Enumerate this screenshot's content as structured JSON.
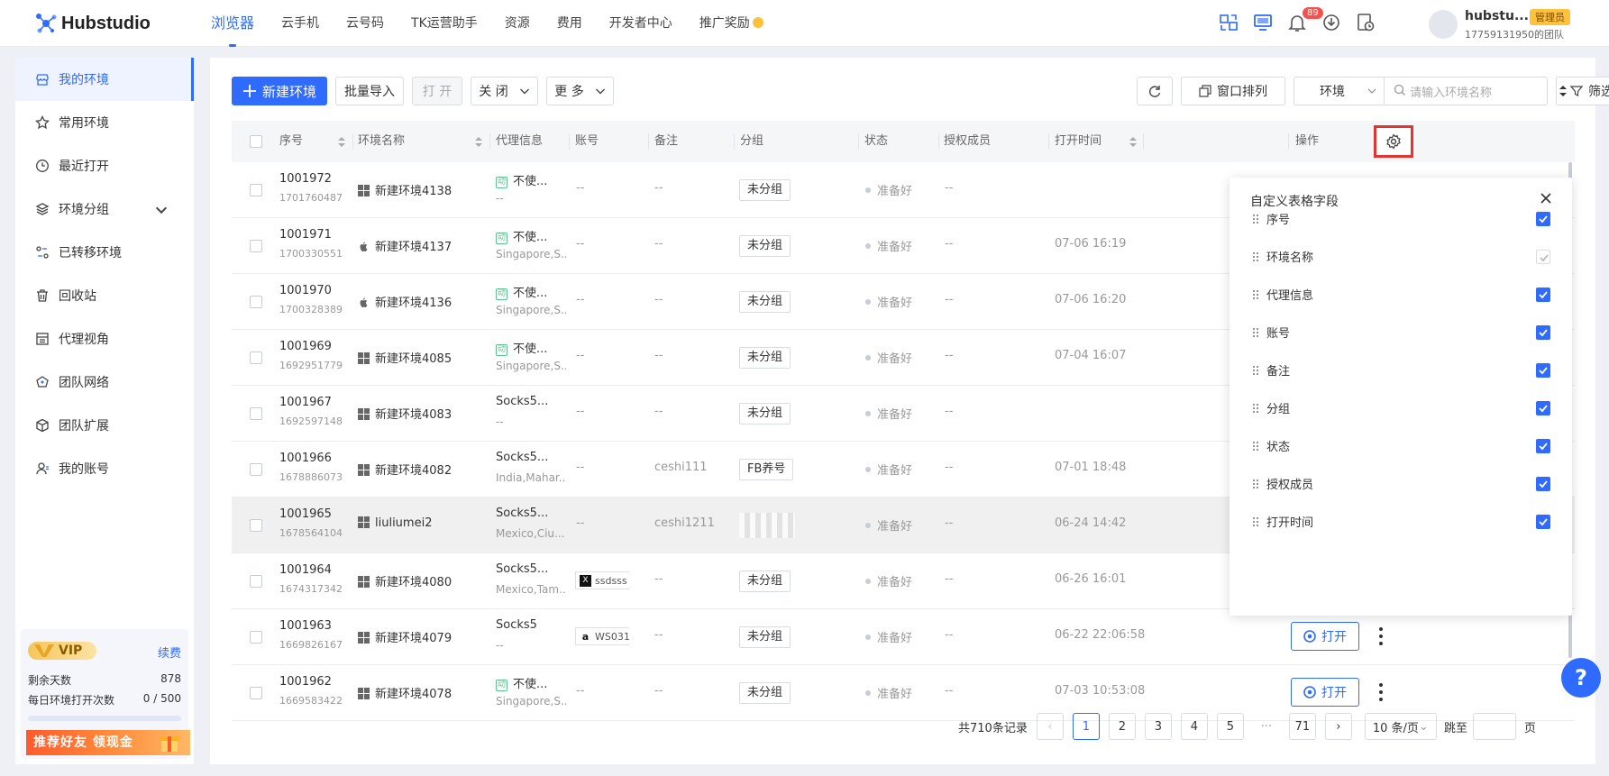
{
  "app": {
    "logo_text": "Hubstudio"
  },
  "nav": {
    "items": [
      "浏览器",
      "云手机",
      "云号码",
      "TK运营助手",
      "资源",
      "费用",
      "开发者中心",
      "推广奖励"
    ]
  },
  "header": {
    "notification_count": "89",
    "user_name": "hubstu...",
    "role": "管理员",
    "team": "17759131950的团队"
  },
  "sidebar": {
    "items": [
      "我的环境",
      "常用环境",
      "最近打开",
      "环境分组",
      "已转移环境",
      "回收站",
      "代理视角",
      "团队网络",
      "团队扩展",
      "我的账号"
    ]
  },
  "vip": {
    "label": "VIP",
    "renew": "续费",
    "days_label": "剩余天数",
    "days_value": "878",
    "opens_label": "每日环境打开次数",
    "opens_value": "0 / 500",
    "promo": "推荐好友 领现金"
  },
  "toolbar": {
    "new_env": "新建环境",
    "batch_import": "批量导入",
    "open": "打 开",
    "close": "关 闭",
    "more": "更 多",
    "window_arrange": "窗口排列",
    "env_select": "环境",
    "search_placeholder": "请输入环境名称",
    "filter": "筛选"
  },
  "table": {
    "headers": [
      "序号",
      "环境名称",
      "代理信息",
      "账号",
      "备注",
      "分组",
      "状态",
      "授权成员",
      "打开时间",
      "操作"
    ],
    "rows": [
      {
        "id": "1001972",
        "sub": "1701760487",
        "os": "windows",
        "name": "新建环境4138",
        "proxy_tag": "动",
        "proxy": "不使...",
        "proxy_sub": "--",
        "account": "--",
        "note": "--",
        "group": "未分组",
        "status": "准备好",
        "members": "--",
        "time": "",
        "highlight": false
      },
      {
        "id": "1001971",
        "sub": "1700330551",
        "os": "apple",
        "name": "新建环境4137",
        "proxy_tag": "动",
        "proxy": "不使...",
        "proxy_sub": "Singapore,S...",
        "account": "--",
        "note": "--",
        "group": "未分组",
        "status": "准备好",
        "members": "--",
        "time": "07-06 16:19",
        "highlight": false
      },
      {
        "id": "1001970",
        "sub": "1700328389",
        "os": "apple",
        "name": "新建环境4136",
        "proxy_tag": "动",
        "proxy": "不使...",
        "proxy_sub": "Singapore,S...",
        "account": "--",
        "note": "--",
        "group": "未分组",
        "status": "准备好",
        "members": "--",
        "time": "07-06 16:20",
        "highlight": false
      },
      {
        "id": "1001969",
        "sub": "1692951779",
        "os": "windows",
        "name": "新建环境4085",
        "proxy_tag": "动",
        "proxy": "不使...",
        "proxy_sub": "Singapore,S...",
        "account": "--",
        "note": "--",
        "group": "未分组",
        "status": "准备好",
        "members": "--",
        "time": "07-04 16:07",
        "highlight": false
      },
      {
        "id": "1001967",
        "sub": "1692597148",
        "os": "windows",
        "name": "新建环境4083",
        "proxy_tag": "",
        "proxy": "Socks5...",
        "proxy_sub": "--",
        "account": "--",
        "note": "--",
        "group": "未分组",
        "status": "准备好",
        "members": "--",
        "time": "",
        "highlight": false
      },
      {
        "id": "1001966",
        "sub": "1678886073",
        "os": "windows",
        "name": "新建环境4082",
        "proxy_tag": "",
        "proxy": "Socks5...",
        "proxy_sub": "India,Mahar...",
        "account": "--",
        "note": "ceshi111",
        "group": "FB养号",
        "status": "准备好",
        "members": "--",
        "time": "07-01 18:48",
        "highlight": false
      },
      {
        "id": "1001965",
        "sub": "1678564104",
        "os": "windows",
        "name": "liuliumei2",
        "proxy_tag": "",
        "proxy": "Socks5...",
        "proxy_sub": "Mexico,Ciu...",
        "account": "--",
        "note": "ceshi1211",
        "group": "",
        "status": "准备好",
        "members": "--",
        "time": "06-24 14:42",
        "highlight": true
      },
      {
        "id": "1001964",
        "sub": "1674317342",
        "os": "windows",
        "name": "新建环境4080",
        "proxy_tag": "",
        "proxy": "Socks5...",
        "proxy_sub": "Mexico,Tam...",
        "account": "ssdsss",
        "account_icon": "x",
        "note": "--",
        "group": "未分组",
        "status": "准备好",
        "members": "--",
        "time": "06-26 16:01",
        "highlight": false
      },
      {
        "id": "1001963",
        "sub": "1669826167",
        "os": "windows",
        "name": "新建环境4079",
        "proxy_tag": "",
        "proxy": "Socks5",
        "proxy_sub": "--",
        "account": "WS031",
        "account_icon": "a",
        "note": "--",
        "group": "未分组",
        "status": "准备好",
        "members": "--",
        "time": "06-22 22:06:58",
        "highlight": false,
        "open_btn": "打开"
      },
      {
        "id": "1001962",
        "sub": "1669583422",
        "os": "windows",
        "name": "新建环境4078",
        "proxy_tag": "动",
        "proxy": "不使...",
        "proxy_sub": "Singapore,S...",
        "account": "--",
        "note": "--",
        "group": "未分组",
        "status": "准备好",
        "members": "--",
        "time": "07-03 10:53:08",
        "highlight": false,
        "open_btn": "打开"
      }
    ]
  },
  "panel": {
    "title": "自定义表格字段",
    "fields": [
      "序号",
      "环境名称",
      "代理信息",
      "账号",
      "备注",
      "分组",
      "状态",
      "授权成员",
      "打开时间"
    ]
  },
  "pagination": {
    "total": "共710条记录",
    "pages": [
      "1",
      "2",
      "3",
      "4",
      "5",
      "···",
      "71"
    ],
    "per_page": "10 条/页",
    "jump": "跳至",
    "page_unit": "页"
  },
  "colors": {
    "accent": "#2f6bff",
    "highlight_border": "#e5332f"
  }
}
